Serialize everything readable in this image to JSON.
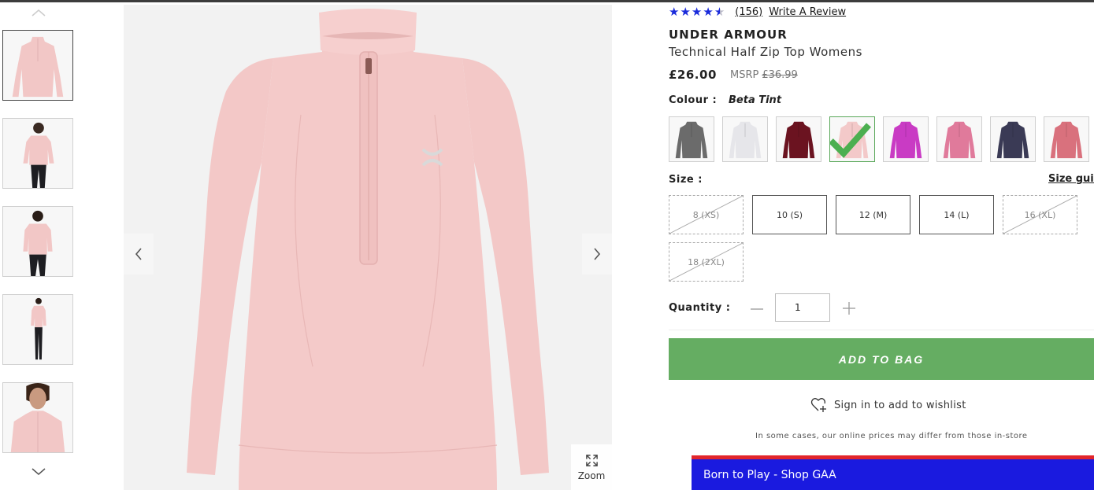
{
  "rating": {
    "stars_value": 4.5,
    "count_label": "(156)",
    "write_review": "Write A Review",
    "star_color": "#1a2bdb"
  },
  "product": {
    "brand": "UNDER ARMOUR",
    "name": "Technical Half Zip Top Womens",
    "price": "£26.00",
    "msrp_label": "MSRP",
    "msrp_price": "£36.99"
  },
  "colour": {
    "label": "Colour :",
    "selected": "Beta Tint",
    "swatches": [
      {
        "name": "grey",
        "color": "#6b6b6b"
      },
      {
        "name": "white",
        "color": "#e6e6ea"
      },
      {
        "name": "maroon",
        "color": "#6b1320"
      },
      {
        "name": "beta-tint",
        "color": "#f3c9c9",
        "selected": true
      },
      {
        "name": "magenta",
        "color": "#c93bc4"
      },
      {
        "name": "pink",
        "color": "#e07a9b"
      },
      {
        "name": "navy",
        "color": "#3a3a55"
      },
      {
        "name": "rose",
        "color": "#d9717d"
      }
    ]
  },
  "size": {
    "label": "Size :",
    "guide": "Size guide",
    "options": [
      {
        "label": "8 (XS)",
        "available": false
      },
      {
        "label": "10 (S)",
        "available": true
      },
      {
        "label": "12 (M)",
        "available": true
      },
      {
        "label": "14 (L)",
        "available": true
      },
      {
        "label": "16 (XL)",
        "available": false
      },
      {
        "label": "18 (2XL)",
        "available": false
      }
    ]
  },
  "quantity": {
    "label": "Quantity :",
    "value": "1"
  },
  "actions": {
    "add_to_bag": "ADD TO BAG",
    "add_to_bag_color": "#65ad62",
    "wishlist": "Sign in to add to wishlist"
  },
  "disclaimer": "In some cases, our online prices may differ from those in-store",
  "promo": {
    "text": "Born to Play - Shop GAA",
    "bg": "#1a1adf",
    "stripe": "#e2262b"
  },
  "gallery": {
    "zoom_label": "Zoom",
    "thumbnail_count": 5,
    "active_index": 0,
    "main_color": "#f2c7c6"
  }
}
